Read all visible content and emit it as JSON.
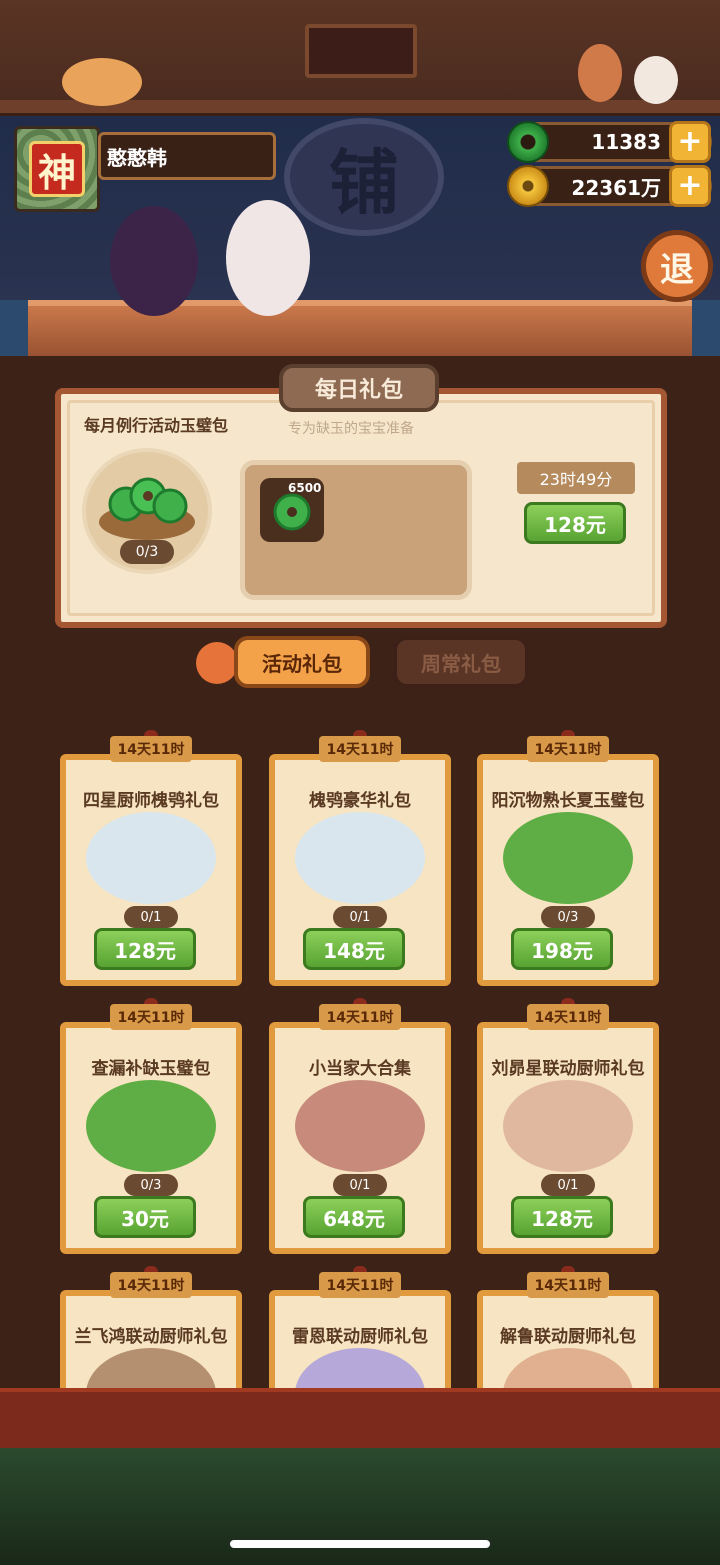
{
  "header": {
    "player_name": "憨憨韩",
    "avatar_label": "神",
    "shop_sign": "铺",
    "currencies": [
      {
        "name": "jade",
        "value": "11383"
      },
      {
        "name": "coins",
        "value": "22361万"
      }
    ],
    "exit_label": "退"
  },
  "daily": {
    "tab_label": "每日礼包",
    "title": "每月例行活动玉璧包",
    "subtitle": "专为缺玉的宝宝准备",
    "progress": "0/3",
    "reward_qty": "6500",
    "timer": "23时49分",
    "price": "128元"
  },
  "tabs": {
    "active": "活动礼包",
    "inactive": "周常礼包"
  },
  "packs": [
    {
      "timer": "14天11时",
      "title": "四星厨师槐鸮礼包",
      "progress": "0/1",
      "price": "128元",
      "art": "chef"
    },
    {
      "timer": "14天11时",
      "title": "槐鸮豪华礼包",
      "progress": "0/1",
      "price": "148元",
      "art": "chef"
    },
    {
      "timer": "14天11时",
      "title": "阳沉物熟长夏玉璧包",
      "progress": "0/3",
      "price": "198元",
      "art": "jade"
    },
    {
      "timer": "14天11时",
      "title": "查漏补缺玉璧包",
      "progress": "0/3",
      "price": "30元",
      "art": "jade"
    },
    {
      "timer": "14天11时",
      "title": "小当家大合集",
      "progress": "0/1",
      "price": "648元",
      "art": "group"
    },
    {
      "timer": "14天11时",
      "title": "刘昴星联动厨师礼包",
      "progress": "0/1",
      "price": "128元",
      "art": "chef"
    },
    {
      "timer": "14天11时",
      "title": "兰飞鸿联动厨师礼包",
      "progress": "",
      "price": "",
      "art": "chef"
    },
    {
      "timer": "14天11时",
      "title": "雷恩联动厨师礼包",
      "progress": "",
      "price": "",
      "art": "chef"
    },
    {
      "timer": "14天11时",
      "title": "解鲁联动厨师礼包",
      "progress": "",
      "price": "",
      "art": "chef"
    }
  ]
}
